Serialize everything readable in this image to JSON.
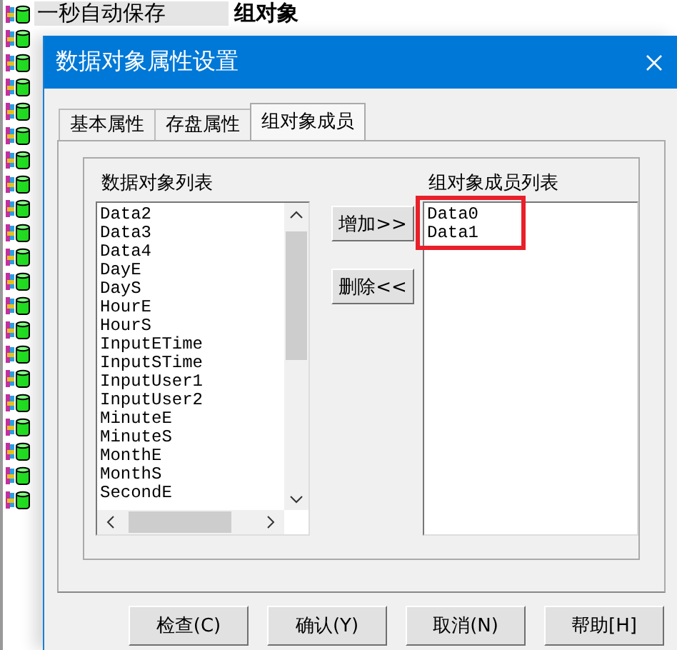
{
  "background_tree": {
    "rows": [
      {
        "name": "一秒自动保存",
        "type": "组对象",
        "selected": true
      }
    ]
  },
  "dialog": {
    "title": "数据对象属性设置",
    "tabs": [
      {
        "label": "基本属性",
        "selected": false
      },
      {
        "label": "存盘属性",
        "selected": false
      },
      {
        "label": "组对象成员",
        "selected": true
      }
    ],
    "objects_list": {
      "label": "数据对象列表",
      "items": [
        "Data2",
        "Data3",
        "Data4",
        "DayE",
        "DayS",
        "HourE",
        "HourS",
        "InputETime",
        "InputSTime",
        "InputUser1",
        "InputUser2",
        "MinuteE",
        "MinuteS",
        "MonthE",
        "MonthS",
        "SecondE"
      ]
    },
    "add_button": "增加>>",
    "remove_button": "删除<<",
    "members_list": {
      "label": "组对象成员列表",
      "items": [
        "Data0",
        "Data1"
      ],
      "highlighted": true
    },
    "buttons": [
      "检查(C)",
      "确认(Y)",
      "取消(N)",
      "帮助[H]"
    ]
  }
}
